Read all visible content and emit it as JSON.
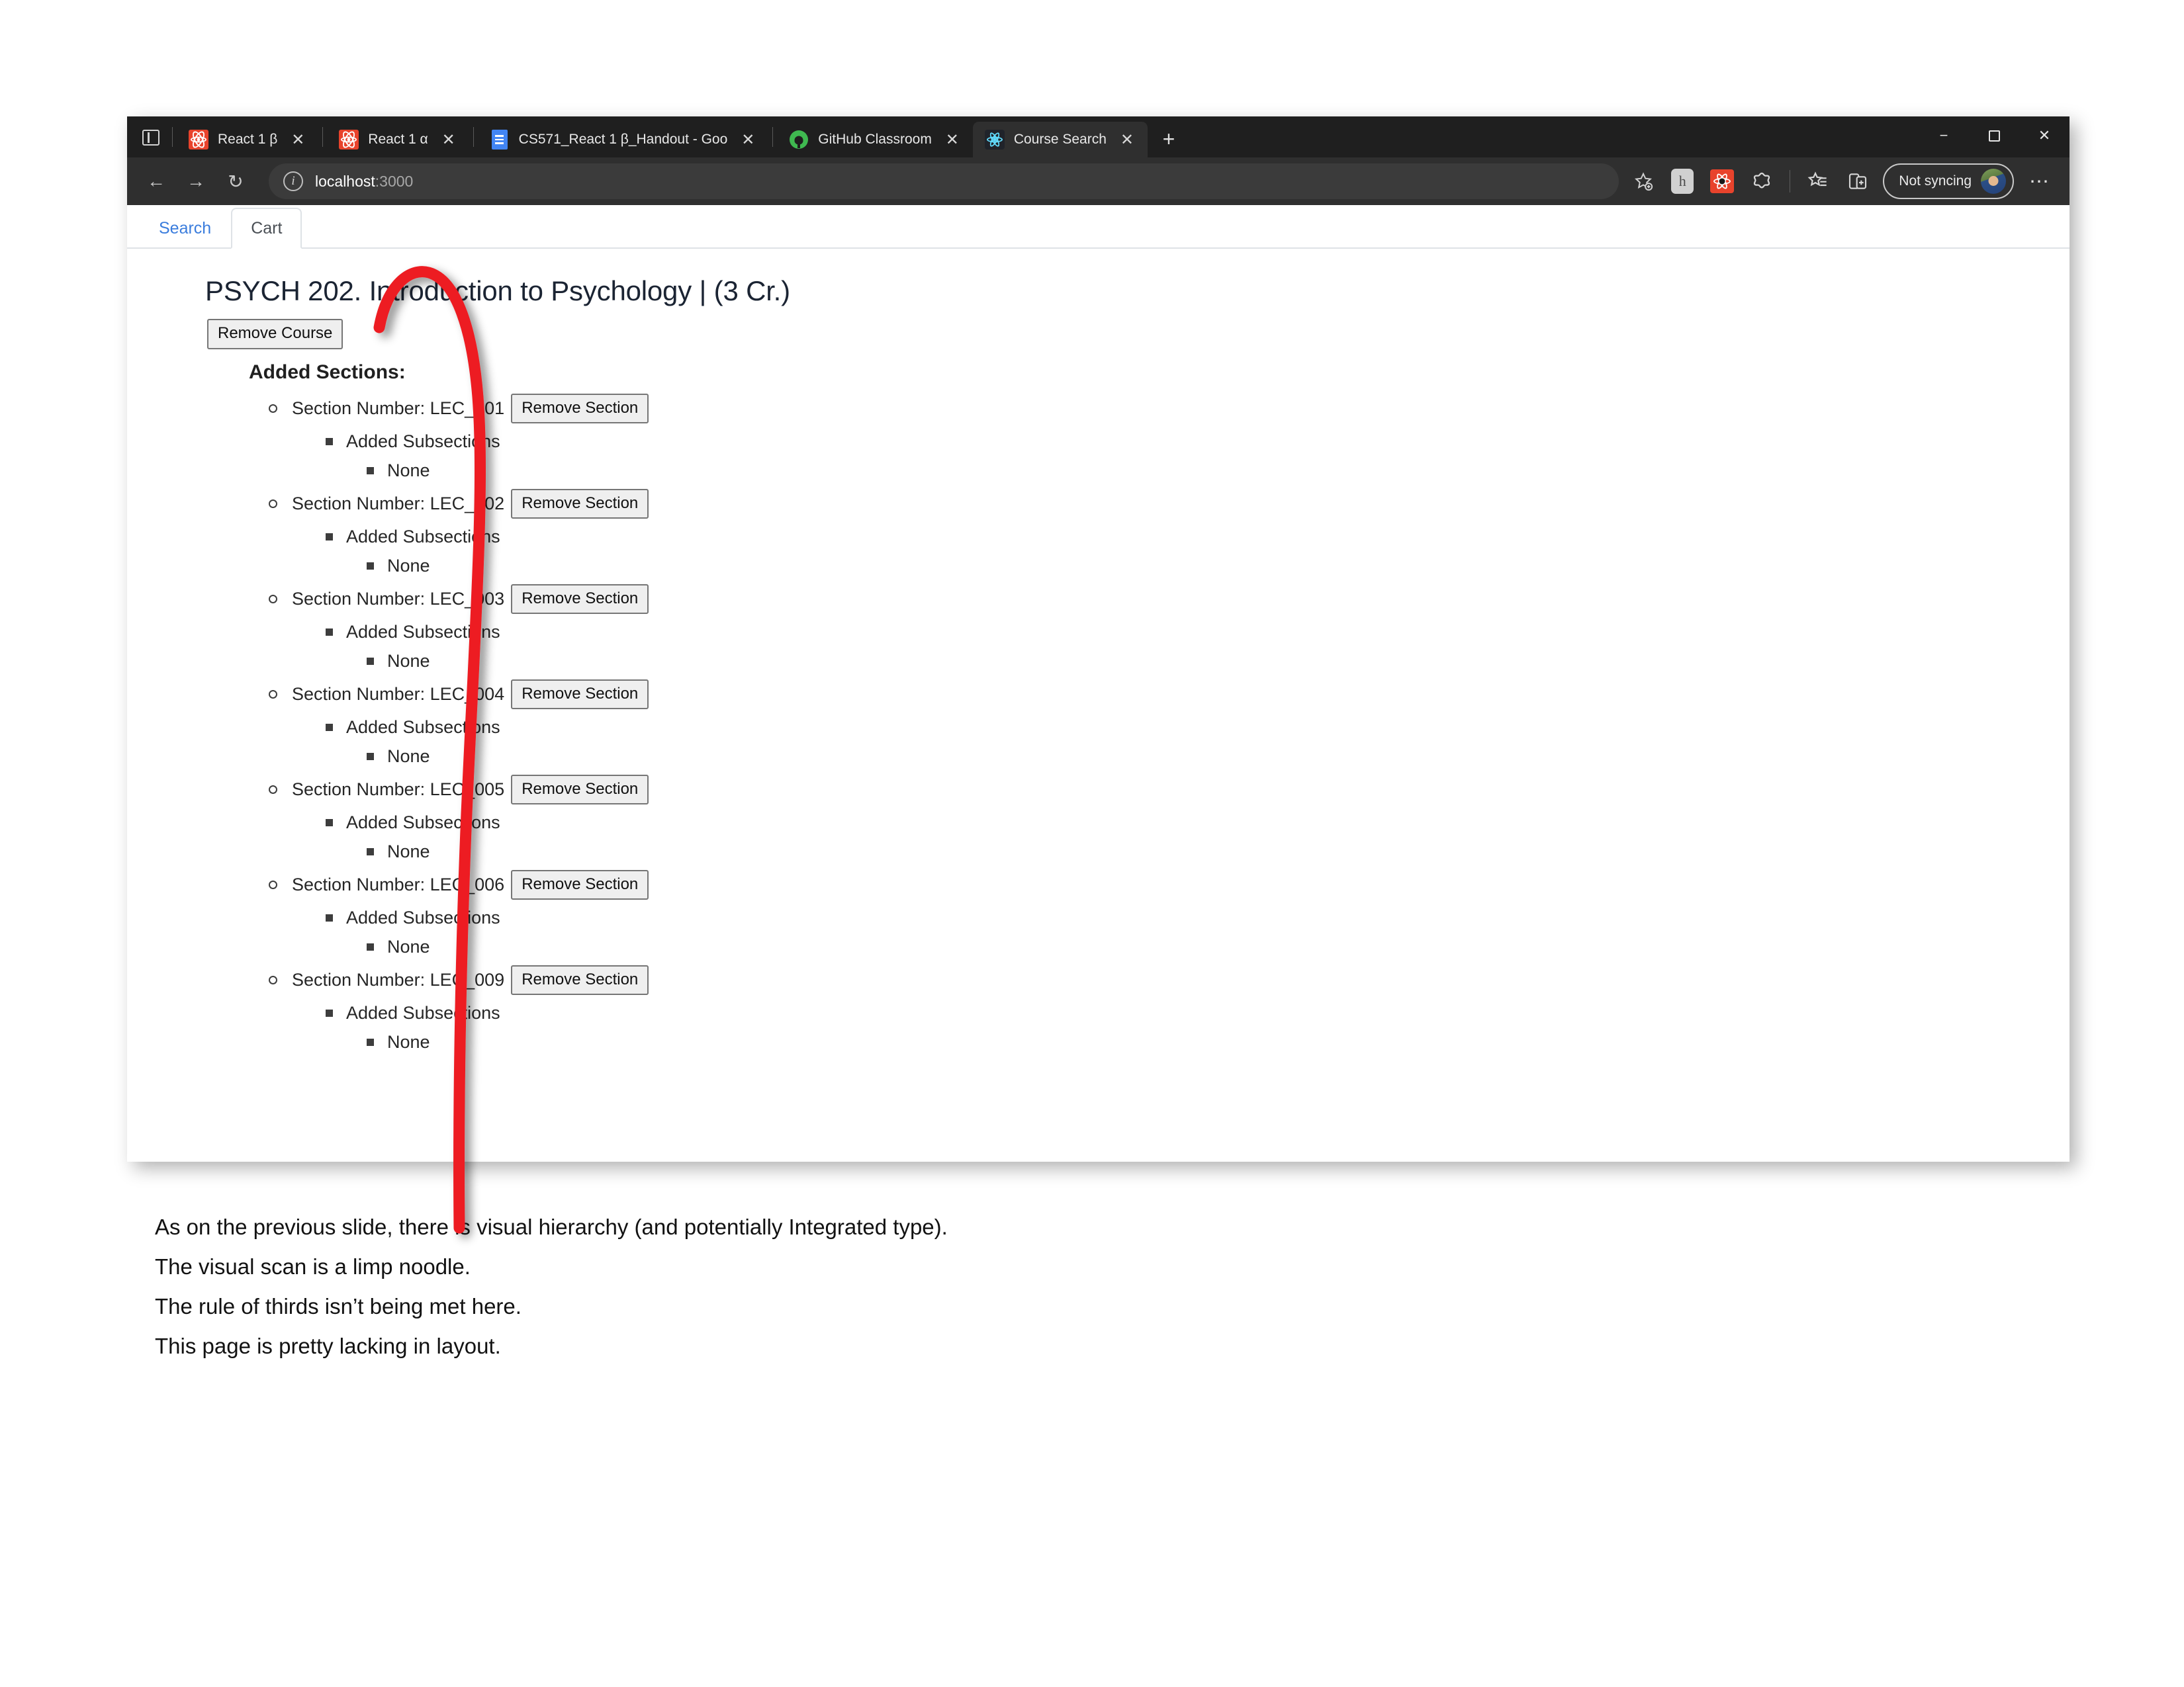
{
  "browser": {
    "tab_search_icon": "tab-search-icon",
    "tabs": [
      {
        "title": "React 1 β",
        "favicon": "react-red-icon",
        "active": false,
        "closable": true
      },
      {
        "title": "React 1 α",
        "favicon": "react-red-icon",
        "active": false,
        "closable": true
      },
      {
        "title": "CS571_React 1 β_Handout - Goo",
        "favicon": "google-docs-icon",
        "active": false,
        "closable": true
      },
      {
        "title": "GitHub Classroom",
        "favicon": "github-icon",
        "active": false,
        "closable": true
      },
      {
        "title": "Course Search",
        "favicon": "react-dark-icon",
        "active": true,
        "closable": true
      }
    ],
    "close_glyph": "✕",
    "new_tab_glyph": "+",
    "window_controls": {
      "minimize": "−",
      "maximize": "maximize-icon",
      "close": "✕"
    },
    "nav": {
      "back": "←",
      "forward": "→",
      "reload": "↻"
    },
    "address": {
      "info_icon": "info-icon",
      "info_glyph": "i",
      "host": "localhost",
      "port": ":3000",
      "favorite_icon": "add-favorite-icon"
    },
    "toolbar_icons": [
      "hypothesis-extension-icon",
      "react-devtools-extension-icon",
      "browser-essentials-icon",
      "collections-icon",
      "split-screen-icon"
    ],
    "profile": {
      "label": "Not syncing",
      "avatar": "avatar"
    },
    "more_glyph": "⋯"
  },
  "app": {
    "tabs": [
      {
        "label": "Search",
        "active": false
      },
      {
        "label": "Cart",
        "active": true
      }
    ],
    "course": {
      "title": "PSYCH 202. Introduction to Psychology | (3 Cr.)",
      "remove_course_label": "Remove Course",
      "added_sections_heading": "Added Sections:",
      "section_label_prefix": "Section Number: ",
      "remove_section_label": "Remove Section",
      "subsections_heading": "Added Subsections",
      "subsections_empty": "None",
      "sections": [
        {
          "number": "LEC_001"
        },
        {
          "number": "LEC_002"
        },
        {
          "number": "LEC_003"
        },
        {
          "number": "LEC_004"
        },
        {
          "number": "LEC_005"
        },
        {
          "number": "LEC_006"
        },
        {
          "number": "LEC_009"
        }
      ]
    }
  },
  "annotations": {
    "curve_color": "#ED1C24",
    "notes": [
      "As on the previous slide, there is visual hierarchy (and potentially Integrated type).",
      "The visual scan is a limp noodle.",
      "The rule of thirds isn’t being met here.",
      "This page is pretty lacking in layout."
    ]
  }
}
